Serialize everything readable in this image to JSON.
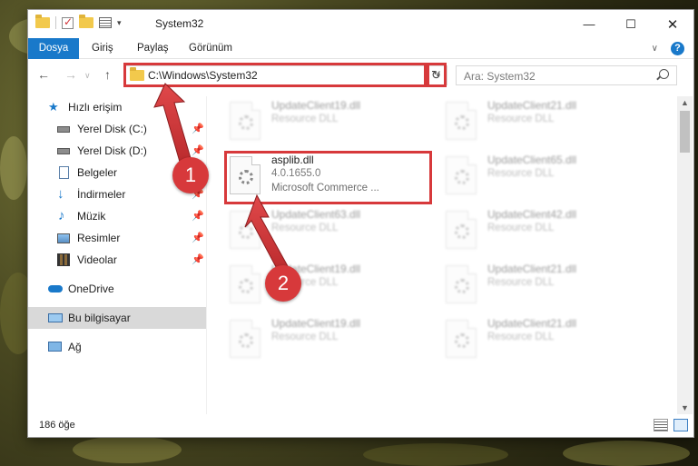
{
  "window": {
    "title": "System32",
    "controls": {
      "minimize": "—",
      "maximize": "☐",
      "close": "✕"
    }
  },
  "ribbon": {
    "tabs": [
      "Dosya",
      "Giriş",
      "Paylaş",
      "Görünüm"
    ],
    "help": "?"
  },
  "nav": {
    "address": "C:\\Windows\\System32",
    "search_placeholder": "Ara: System32",
    "back": "←",
    "forward": "→",
    "up": "↑",
    "refresh": "↻"
  },
  "sidebar": {
    "items": [
      {
        "label": "Hızlı erişim",
        "icon": "star-icon",
        "pinned": false
      },
      {
        "label": "Yerel Disk (C:)",
        "icon": "drive-icon",
        "pinned": true
      },
      {
        "label": "Yerel Disk (D:)",
        "icon": "drive-icon",
        "pinned": true
      },
      {
        "label": "Belgeler",
        "icon": "documents-icon",
        "pinned": true
      },
      {
        "label": "İndirmeler",
        "icon": "download-icon",
        "pinned": true
      },
      {
        "label": "Müzik",
        "icon": "music-icon",
        "pinned": true
      },
      {
        "label": "Resimler",
        "icon": "pictures-icon",
        "pinned": true
      },
      {
        "label": "Videolar",
        "icon": "videos-icon",
        "pinned": true
      },
      {
        "label": "OneDrive",
        "icon": "cloud-icon",
        "pinned": false
      },
      {
        "label": "Bu bilgisayar",
        "icon": "computer-icon",
        "pinned": false,
        "selected": true
      },
      {
        "label": "Ağ",
        "icon": "network-icon",
        "pinned": false
      }
    ]
  },
  "files": {
    "left": [
      {
        "name": "UpdateClient19.dll",
        "l2": "Resource DLL",
        "l3": ""
      },
      {
        "name": "asplib.dll",
        "l2": "4.0.1655.0",
        "l3": "Microsoft Commerce ...",
        "highlight": true
      },
      {
        "name": "UpdateClient63.dll",
        "l2": "Resource DLL",
        "l3": ""
      },
      {
        "name": "UpdateClient19.dll",
        "l2": "Resource DLL",
        "l3": ""
      },
      {
        "name": "UpdateClient19.dll",
        "l2": "Resource DLL",
        "l3": ""
      }
    ],
    "right": [
      {
        "name": "UpdateClient21.dll",
        "l2": "Resource DLL",
        "l3": ""
      },
      {
        "name": "UpdateClient65.dll",
        "l2": "Resource DLL",
        "l3": ""
      },
      {
        "name": "UpdateClient42.dll",
        "l2": "Resource DLL",
        "l3": ""
      },
      {
        "name": "UpdateClient21.dll",
        "l2": "Resource DLL",
        "l3": ""
      },
      {
        "name": "UpdateClient21.dll",
        "l2": "Resource DLL",
        "l3": ""
      }
    ]
  },
  "status": {
    "count": "186 öğe"
  },
  "annotations": {
    "badge1": "1",
    "badge2": "2",
    "accent_color": "#d7393b"
  }
}
